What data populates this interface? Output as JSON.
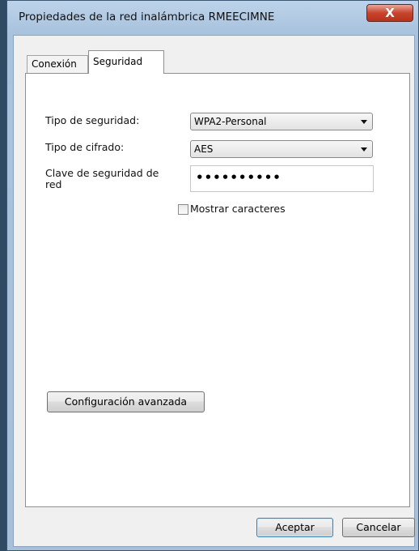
{
  "window": {
    "title": "Propiedades de la red inalámbrica RMEECIMNE",
    "close_glyph": "X"
  },
  "tabs": [
    {
      "label": "Conexión",
      "active": false
    },
    {
      "label": "Seguridad",
      "active": true
    }
  ],
  "security": {
    "type_label": "Tipo de seguridad:",
    "type_value": "WPA2-Personal",
    "cipher_label": "Tipo de cifrado:",
    "cipher_value": "AES",
    "key_label": "Clave de seguridad de red",
    "key_value": "••••••••••",
    "show_chars_label": "Mostrar caracteres",
    "show_chars_checked": false
  },
  "advanced_button": "Configuración avanzada",
  "footer": {
    "ok": "Aceptar",
    "cancel": "Cancelar"
  }
}
